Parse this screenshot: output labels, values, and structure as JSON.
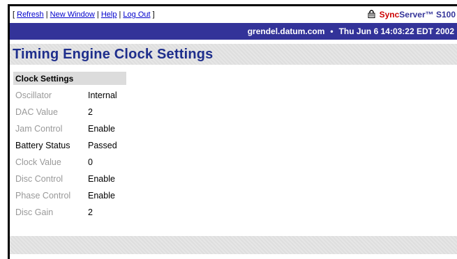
{
  "toolbar": {
    "open_bracket": "[",
    "close_bracket": "]",
    "separator": "|",
    "refresh_label": "Refresh",
    "new_window_label": "New Window",
    "help_label": "Help",
    "logout_label": "Log Out"
  },
  "brand": {
    "sync": "Sync",
    "rest": "Server™ S100",
    "icon": "lock-icon"
  },
  "banner": {
    "host": "grendel.datum.com",
    "separator": "•",
    "datetime": "Thu Jun 6 14:03:22 EDT 2002"
  },
  "page": {
    "title": "Timing Engine Clock Settings"
  },
  "clock_settings": {
    "heading": "Clock Settings",
    "rows": [
      {
        "label": "Oscillator",
        "value": "Internal"
      },
      {
        "label": "DAC Value",
        "value": "2"
      },
      {
        "label": "Jam Control",
        "value": "Enable"
      },
      {
        "label": "Battery Status",
        "value": "Passed"
      },
      {
        "label": "Clock Value",
        "value": "0"
      },
      {
        "label": "Disc Control",
        "value": "Enable"
      },
      {
        "label": "Phase Control",
        "value": "Enable"
      },
      {
        "label": "Disc Gain",
        "value": "2"
      }
    ]
  },
  "colors": {
    "banner": "#333399",
    "title": "#1e2e8c",
    "brand_red": "#cc0000"
  }
}
